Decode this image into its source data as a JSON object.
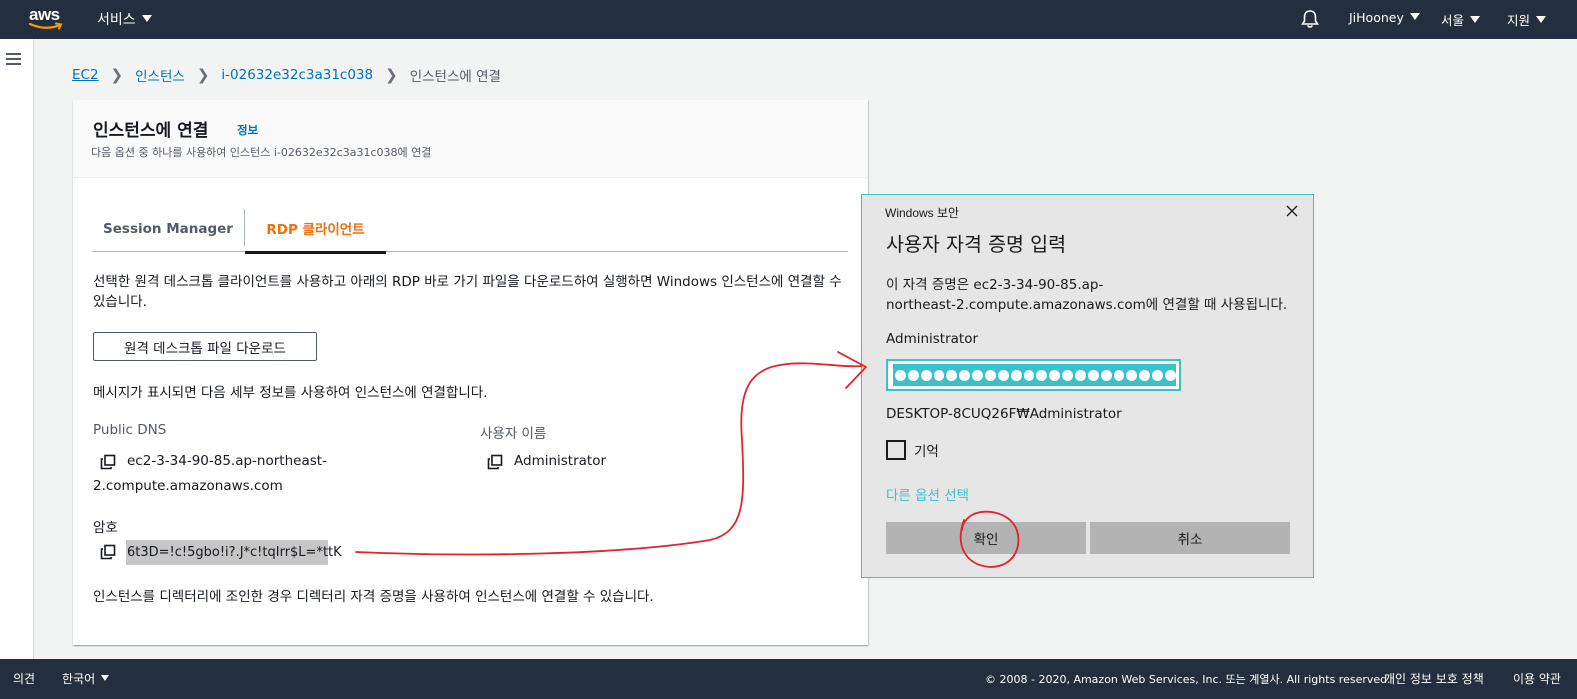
{
  "topnav": {
    "logo_text": "aws",
    "services": "서비스",
    "user": "JiHooney",
    "region": "서울",
    "support": "지원"
  },
  "breadcrumb": {
    "ec2": "EC2",
    "instances": "인스턴스",
    "instance_id": "i-02632e32c3a31c038",
    "current": "인스턴스에 연결"
  },
  "card": {
    "title": "인스턴스에 연결",
    "info": "정보",
    "subtitle": "다음 옵션 중 하나를 사용하여 인스턴스 i-02632e32c3a31c038에 연결",
    "tabs": [
      "Session Manager",
      "RDP 클라이언트"
    ],
    "description": "선택한 원격 데스크톱 클라이언트를 사용하고 아래의 RDP 바로 가기 파일을 다운로드하여 실행하면 Windows 인스턴스에 연결할 수 있습니다.",
    "download_button": "원격 데스크톱 파일 다운로드",
    "message": "메시지가 표시되면 다음 세부 정보를 사용하여 인스턴스에 연결합니다.",
    "public_dns_label": "Public DNS",
    "public_dns_line1": "ec2-3-34-90-85.ap-northeast-",
    "public_dns_line2": "2.compute.amazonaws.com",
    "username_label": "사용자 이름",
    "username_value": "Administrator",
    "password_label": "암호",
    "password_value": "6t3D=!c!5gbo!i?.J*c!tqIrr$L=*ttK",
    "note": "인스턴스를 디렉터리에 조인한 경우 디렉터리 자격 증명을 사용하여 인스턴스에 연결할 수 있습니다."
  },
  "dialog": {
    "caption": "Windows 보안",
    "title": "사용자 자격 증명 입력",
    "text_line1": "이 자격 증명은 ec2-3-34-90-85.ap-",
    "text_line2": "northeast-2.compute.amazonaws.com에 연결할 때 사용됩니다.",
    "user_label": "Administrator",
    "account": "DESKTOP-8CUQ26F₩Administrator",
    "remember": "기억",
    "more_options": "다른 옵션 선택",
    "ok": "확인",
    "cancel": "취소",
    "password_dot_count": 22
  },
  "footer": {
    "feedback": "의견",
    "language": "한국어",
    "copyright": "© 2008 - 2020, Amazon Web Services, Inc. 또는 계열사. All rights reserved.",
    "privacy": "개인 정보 보호 정책",
    "terms": "이용 약관"
  },
  "colors": {
    "navbar": "#232f3e",
    "link": "#0073bb",
    "active_tab": "#ec7211",
    "win_accent": "#3bc1c9",
    "annotation": "#e0242b"
  }
}
